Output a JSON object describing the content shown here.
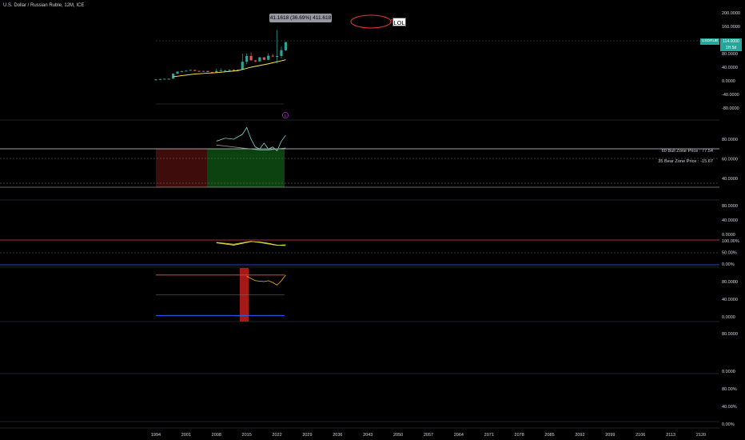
{
  "header": {
    "title": "U.S. Dollar / Russian Ruble, 12M, ICE"
  },
  "tooltip": {
    "text": "41.1618 (36.69%) 411.618"
  },
  "annotation": {
    "label": "LOL"
  },
  "price_label": {
    "symbol": "USDRUB",
    "price": "114.0000",
    "countdown": "1H 5d"
  },
  "zones": {
    "bull": "60 Bull Zone Price : 77.54",
    "bear": "35 Bear Zone Price : -15.67"
  },
  "colors": {
    "up": "#26a69a",
    "down": "#ef5350",
    "ma": "#ffeb3b",
    "osc": "#7fd3c7",
    "bull_bg": "#0d4d12",
    "bear_bg": "#4a0e0e",
    "upper": "#f23645",
    "lower": "#2962ff"
  },
  "chart_data": [
    {
      "type": "candlestick",
      "pane": "price",
      "x": [
        "1994",
        "2001",
        "2008",
        "2015",
        "2022",
        "2029",
        "2036",
        "2043",
        "2050",
        "2057",
        "2064",
        "2071",
        "2078",
        "2085",
        "2092",
        "2099",
        "2106",
        "2113",
        "2120"
      ],
      "y_ticks": [
        "200.0000",
        "160.0000",
        "120.0000",
        "80.0000",
        "40.0000",
        "0.0000",
        "-40.0000",
        "-80.0000"
      ],
      "ohlc": [
        {
          "year": 1994,
          "o": 2,
          "h": 5,
          "l": 1,
          "c": 4
        },
        {
          "year": 1995,
          "o": 4,
          "h": 6,
          "l": 4,
          "c": 5
        },
        {
          "year": 1996,
          "o": 5,
          "h": 6,
          "l": 5,
          "c": 6
        },
        {
          "year": 1997,
          "o": 6,
          "h": 7,
          "l": 5,
          "c": 6
        },
        {
          "year": 1998,
          "o": 6,
          "h": 22,
          "l": 6,
          "c": 21
        },
        {
          "year": 1999,
          "o": 21,
          "h": 28,
          "l": 20,
          "c": 27
        },
        {
          "year": 2000,
          "o": 27,
          "h": 29,
          "l": 26,
          "c": 28
        },
        {
          "year": 2001,
          "o": 28,
          "h": 31,
          "l": 28,
          "c": 30
        },
        {
          "year": 2002,
          "o": 30,
          "h": 32,
          "l": 30,
          "c": 32
        },
        {
          "year": 2003,
          "o": 32,
          "h": 32,
          "l": 29,
          "c": 29
        },
        {
          "year": 2004,
          "o": 29,
          "h": 30,
          "l": 28,
          "c": 28
        },
        {
          "year": 2005,
          "o": 28,
          "h": 29,
          "l": 27,
          "c": 29
        },
        {
          "year": 2006,
          "o": 29,
          "h": 29,
          "l": 26,
          "c": 26
        },
        {
          "year": 2007,
          "o": 26,
          "h": 26,
          "l": 24,
          "c": 25
        },
        {
          "year": 2008,
          "o": 25,
          "h": 36,
          "l": 23,
          "c": 29
        },
        {
          "year": 2009,
          "o": 29,
          "h": 37,
          "l": 28,
          "c": 30
        },
        {
          "year": 2010,
          "o": 30,
          "h": 32,
          "l": 29,
          "c": 30
        },
        {
          "year": 2011,
          "o": 30,
          "h": 34,
          "l": 27,
          "c": 32
        },
        {
          "year": 2012,
          "o": 32,
          "h": 34,
          "l": 30,
          "c": 31
        },
        {
          "year": 2013,
          "o": 31,
          "h": 33,
          "l": 31,
          "c": 33
        },
        {
          "year": 2014,
          "o": 33,
          "h": 80,
          "l": 32,
          "c": 56
        },
        {
          "year": 2015,
          "o": 56,
          "h": 80,
          "l": 49,
          "c": 73
        },
        {
          "year": 2016,
          "o": 73,
          "h": 84,
          "l": 60,
          "c": 60
        },
        {
          "year": 2017,
          "o": 60,
          "h": 61,
          "l": 55,
          "c": 57
        },
        {
          "year": 2018,
          "o": 57,
          "h": 70,
          "l": 56,
          "c": 69
        },
        {
          "year": 2019,
          "o": 69,
          "h": 69,
          "l": 61,
          "c": 62
        },
        {
          "year": 2020,
          "o": 62,
          "h": 81,
          "l": 61,
          "c": 74
        },
        {
          "year": 2021,
          "o": 74,
          "h": 79,
          "l": 70,
          "c": 73
        },
        {
          "year": 2022,
          "o": 73,
          "h": 150,
          "l": 51,
          "c": 73
        },
        {
          "year": 2023,
          "o": 73,
          "h": 101,
          "l": 66,
          "c": 90
        },
        {
          "year": 2024,
          "o": 90,
          "h": 114,
          "l": 88,
          "c": 114
        }
      ],
      "last_price": 114.0,
      "moving_average": [
        {
          "year": 1998,
          "v": 12
        },
        {
          "year": 2003,
          "v": 20
        },
        {
          "year": 2008,
          "v": 24
        },
        {
          "year": 2013,
          "v": 30
        },
        {
          "year": 2016,
          "v": 40
        },
        {
          "year": 2020,
          "v": 50
        },
        {
          "year": 2024,
          "v": 62
        }
      ]
    },
    {
      "type": "line",
      "pane": "zones",
      "y_ticks": [
        "80.0000",
        "60.0000",
        "40.0000"
      ],
      "series": [
        {
          "x": [
            2008,
            2010,
            2012,
            2014,
            2015,
            2016,
            2017,
            2018,
            2019,
            2020,
            2021,
            2022,
            2023,
            2024
          ],
          "values": [
            78,
            81,
            80,
            85,
            92,
            80,
            72,
            70,
            76,
            70,
            72,
            68,
            78,
            84
          ]
        },
        {
          "x": [
            2008,
            2010,
            2012,
            2014,
            2016,
            2018,
            2020,
            2022,
            2024
          ],
          "values": [
            74,
            73,
            72,
            71,
            70,
            69,
            69,
            70,
            71
          ]
        }
      ],
      "bull_zone": 77.54,
      "bear_zone": -15.67
    },
    {
      "type": "line",
      "pane": "oscillator",
      "y_ticks": [
        "80.0000",
        "40.0000",
        "0.0000"
      ],
      "y2_ticks": [
        "100.00%",
        "50.00%",
        "0.00%"
      ],
      "series": [
        {
          "x": [
            2008,
            2010,
            2012,
            2014,
            2016,
            2018,
            2020,
            2022,
            2024
          ],
          "values": [
            62,
            57,
            52,
            60,
            68,
            66,
            60,
            52,
            50
          ]
        },
        {
          "x": [
            2008,
            2010,
            2012,
            2014,
            2016,
            2018,
            2020,
            2022,
            2024
          ],
          "values": [
            64,
            60,
            56,
            63,
            69,
            64,
            57,
            51,
            54
          ]
        }
      ]
    },
    {
      "type": "line",
      "pane": "rsi",
      "y_ticks": [
        "80.0000",
        "40.0000",
        "0.0000"
      ],
      "series": [
        {
          "x": [
            2015,
            2017,
            2019,
            2020,
            2021,
            2022,
            2023,
            2024
          ],
          "values": [
            92,
            82,
            80,
            82,
            78,
            72,
            82,
            95
          ]
        }
      ],
      "bands": [
        95,
        50,
        3
      ]
    },
    {
      "type": "line",
      "pane": "empty",
      "y_ticks": [
        "80.0000",
        "0.0000"
      ],
      "series": []
    },
    {
      "type": "line",
      "pane": "empty",
      "y_ticks": [
        "80.00%",
        "40.00%",
        "0.00%"
      ],
      "series": []
    }
  ]
}
